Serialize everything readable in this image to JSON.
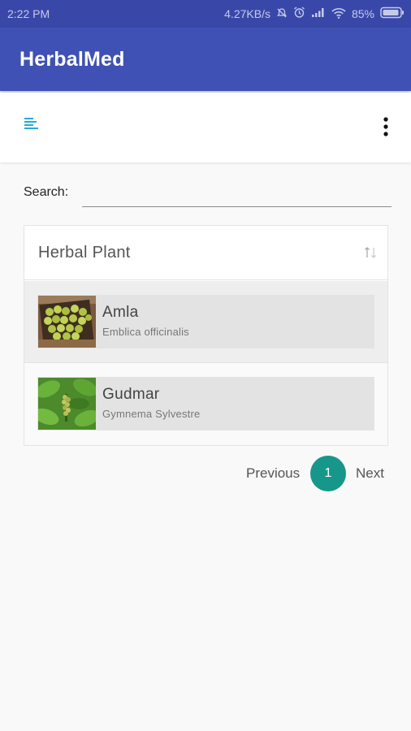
{
  "status_bar": {
    "time": "2:22 PM",
    "network_speed": "4.27KB/s",
    "battery": "85%",
    "icons": [
      "mute-icon",
      "alarm-icon",
      "signal-icon",
      "wifi-icon",
      "battery-icon"
    ]
  },
  "app_bar": {
    "title": "HerbalMed"
  },
  "toolbar": {
    "icons": [
      "menu-icon",
      "more-vert-icon"
    ]
  },
  "search": {
    "label": "Search:",
    "value": "",
    "placeholder": ""
  },
  "table": {
    "header": "Herbal Plant",
    "sort_icon": "sort-arrows-icon",
    "rows": [
      {
        "name": "Amla",
        "scientific_name": "Emblica officinalis",
        "image": "amla-fruit-thumbnail"
      },
      {
        "name": "Gudmar",
        "scientific_name": "Gymnema Sylvestre",
        "image": "gudmar-leaves-thumbnail"
      }
    ]
  },
  "pagination": {
    "previous": "Previous",
    "current_page": "1",
    "next": "Next"
  },
  "colors": {
    "status_bar": "#3948a8",
    "app_bar": "#3f51b5",
    "accent": "#16978a",
    "menu_icon": "#29a8e0"
  }
}
